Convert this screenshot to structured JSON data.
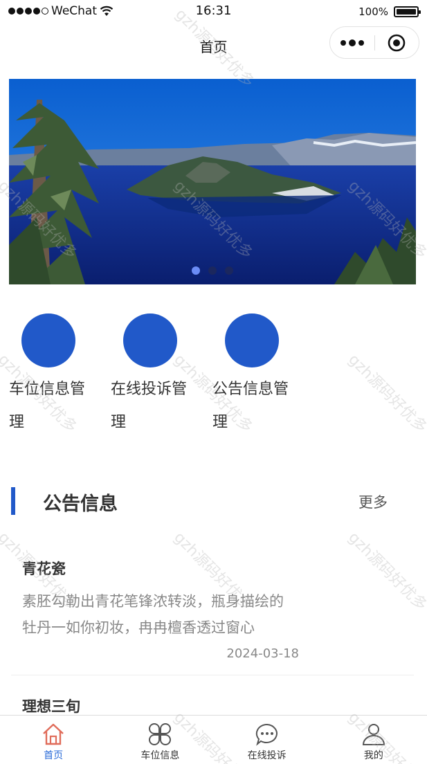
{
  "status_bar": {
    "carrier": "WeChat",
    "time": "16:31",
    "battery": "100%"
  },
  "nav": {
    "title": "首页"
  },
  "banner": {
    "slide_count": 3,
    "active_index": 0
  },
  "menu": [
    {
      "label": "车位信息管理"
    },
    {
      "label": "在线投诉管理"
    },
    {
      "label": "公告信息管理"
    }
  ],
  "section": {
    "title": "公告信息",
    "more": "更多"
  },
  "notices": [
    {
      "title": "青花瓷",
      "summary": "素胚勾勒出青花笔锋浓转淡，瓶身描绘的牡丹一如你初妆，冉冉檀香透过窗心",
      "date": "2024-03-18"
    },
    {
      "title": "理想三旬",
      "summary": "",
      "date": ""
    }
  ],
  "tabbar": [
    {
      "label": "首页",
      "icon": "home-icon",
      "active": true
    },
    {
      "label": "车位信息",
      "icon": "grid-icon",
      "active": false
    },
    {
      "label": "在线投诉",
      "icon": "chat-bubble-icon",
      "active": false
    },
    {
      "label": "我的",
      "icon": "user-icon",
      "active": false
    }
  ],
  "watermark": "gzh源码好优多",
  "colors": {
    "accent": "#2159c9",
    "tab_active": "#2a6bd8",
    "home_icon": "#e06c5a"
  }
}
